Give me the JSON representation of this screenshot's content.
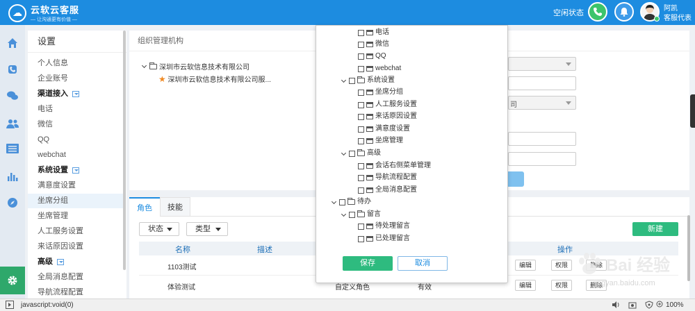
{
  "app": {
    "logo_title": "云软云客服",
    "logo_subtitle": "— 让沟通更有价值 —"
  },
  "header": {
    "status": "空闲状态",
    "user_name": "阿凯",
    "user_role": "客服代表"
  },
  "rail": {
    "icons": [
      "home-icon",
      "phone-icon",
      "chat-icon",
      "contacts-icon",
      "list-icon",
      "chart-icon",
      "compass-icon",
      "settings-icon"
    ]
  },
  "sidebar": {
    "title": "设置",
    "items": [
      {
        "label": "个人信息",
        "bold": false
      },
      {
        "label": "企业账号",
        "bold": false
      },
      {
        "label": "渠道接入",
        "bold": true
      },
      {
        "label": "电话",
        "bold": false
      },
      {
        "label": "微信",
        "bold": false
      },
      {
        "label": "QQ",
        "bold": false
      },
      {
        "label": "webchat",
        "bold": false
      },
      {
        "label": "系统设置",
        "bold": true
      },
      {
        "label": "满意度设置",
        "bold": false
      },
      {
        "label": "坐席分组",
        "bold": false
      },
      {
        "label": "坐席管理",
        "bold": false
      },
      {
        "label": "人工服务设置",
        "bold": false
      },
      {
        "label": "来话原因设置",
        "bold": false
      },
      {
        "label": "高级",
        "bold": true
      },
      {
        "label": "全局消息配置",
        "bold": false
      },
      {
        "label": "导航流程配置",
        "bold": false
      }
    ]
  },
  "org_panel": {
    "title": "组织管理机构",
    "root": "深圳市云软信息技术有限公司",
    "child": "深圳市云软信息技术有限公司服...",
    "field_fragment": "司"
  },
  "roles_panel": {
    "tabs": [
      "角色",
      "技能"
    ],
    "filter_status": "状态",
    "filter_type": "类型",
    "create_label": "新建",
    "columns": {
      "name": "名称",
      "desc": "描述",
      "ops": "操作"
    },
    "rows": [
      {
        "name": "1103测试",
        "type": "",
        "state": "",
        "edit": "编辑",
        "perm": "权限",
        "delete": "删除"
      },
      {
        "name": "体验测试",
        "type": "自定义角色",
        "state": "有效",
        "edit": "编辑",
        "perm": "权限",
        "delete": "删除"
      }
    ]
  },
  "popup": {
    "items": [
      "电话",
      "微信",
      "QQ",
      "webchat",
      "系统设置",
      "坐席分组",
      "人工服务设置",
      "来话原因设置",
      "满意度设置",
      "坐席管理",
      "高级",
      "会话右侧菜单管理",
      "导航流程配置",
      "全局消息配置",
      "待办",
      "留言",
      "待处理留言",
      "已处理留言"
    ],
    "save": "保存",
    "cancel": "取消"
  },
  "watermark": {
    "title": "Bai 经验",
    "url": "jingyan.baidu.com"
  },
  "statusbar": {
    "text": "javascript:void(0)",
    "zoom": "100%"
  },
  "colors": {
    "header_blue": "#1d8ce0",
    "green": "#2ebb7f",
    "rail_bg": "#e3eaf2"
  }
}
